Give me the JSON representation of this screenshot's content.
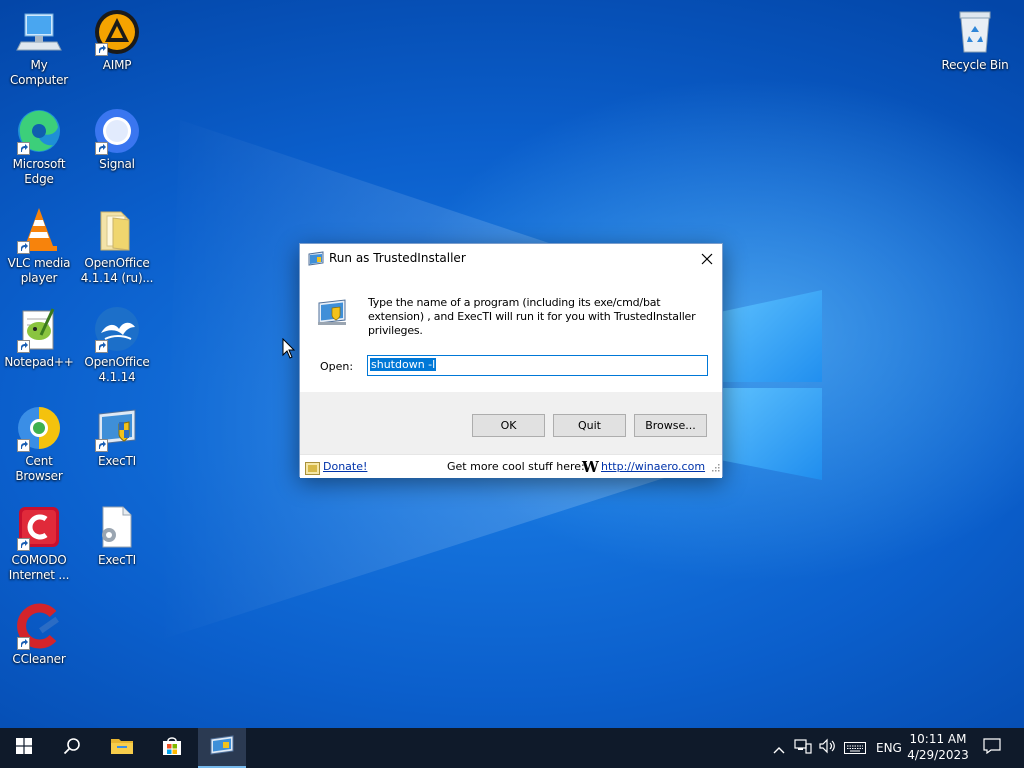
{
  "desktop": {
    "icons": [
      {
        "label": "My Computer"
      },
      {
        "label": "AIMP"
      },
      {
        "label": "Microsoft Edge"
      },
      {
        "label": "Signal"
      },
      {
        "label": "VLC media player"
      },
      {
        "label": "OpenOffice 4.1.14 (ru)..."
      },
      {
        "label": "Notepad++"
      },
      {
        "label": "OpenOffice 4.1.14"
      },
      {
        "label": "Cent Browser"
      },
      {
        "label": "ExecTI"
      },
      {
        "label": "COMODO Internet ..."
      },
      {
        "label": "ExecTI"
      },
      {
        "label": "CCleaner"
      },
      {
        "label": "Recycle Bin"
      }
    ]
  },
  "dialog": {
    "title": "Run as TrustedInstaller",
    "description": "Type the name of a program (including its exe/cmd/bat extension) , and ExecTI will run it for you with TrustedInstaller privileges.",
    "open_label": "Open:",
    "open_value": "shutdown -l",
    "buttons": {
      "ok": "OK",
      "quit": "Quit",
      "browse": "Browse..."
    },
    "footer": {
      "donate": "Donate!",
      "cool_stuff": "Get more cool stuff here:",
      "logo": "W",
      "link": "http://winaero.com"
    }
  },
  "taskbar": {
    "language": "ENG",
    "time": "10:11 AM",
    "date": "4/29/2023"
  }
}
